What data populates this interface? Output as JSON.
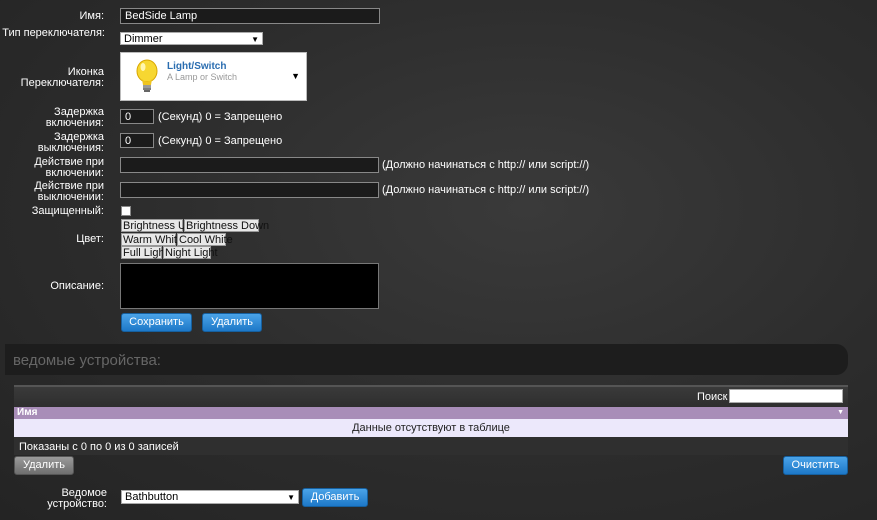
{
  "form": {
    "name": {
      "label": "Имя:",
      "value": "BedSide Lamp"
    },
    "switch_type": {
      "label": "Тип переключателя:",
      "value": "Dimmer"
    },
    "switch_icon": {
      "label": "Иконка Переключателя:",
      "title": "Light/Switch",
      "subtitle": "A Lamp or Switch"
    },
    "on_delay": {
      "label": "Задержка включения:",
      "value": "0",
      "hint": "(Секунд) 0 = Запрещено"
    },
    "off_delay": {
      "label": "Задержка выключения:",
      "value": "0",
      "hint": "(Секунд) 0 = Запрещено"
    },
    "on_action": {
      "label": "Действие при включении:",
      "value": "",
      "hint": "(Должно начинаться с http:// или script://)"
    },
    "off_action": {
      "label": "Действие при выключении:",
      "value": "",
      "hint": "(Должно начинаться с http:// или script://)"
    },
    "protected": {
      "label": "Защищенный:",
      "checked": false
    },
    "color": {
      "label": "Цвет:",
      "buttons": [
        "Brightness Up",
        "Brightness Down",
        "Warm White",
        "Cool White",
        "Full Light",
        "Night Light"
      ]
    },
    "description": {
      "label": "Описание:",
      "value": ""
    },
    "save_label": "Сохранить",
    "delete_label": "Удалить"
  },
  "slaves": {
    "title": "ведомые устройства:",
    "search_label": "Поиск",
    "search_value": "",
    "column_name": "Имя",
    "empty_text": "Данные отсутствуют в таблице",
    "info_text": "Показаны с 0 по 0 из 0 записей",
    "delete_label": "Удалить",
    "clear_label": "Очистить",
    "slave_device_label": "Ведомое устройство:",
    "slave_device_value": "Bathbutton",
    "add_label": "Добавить"
  },
  "colors": {
    "accent": "#1d78c8",
    "table_header": "#a88db8",
    "table_row": "#ece8fb"
  }
}
